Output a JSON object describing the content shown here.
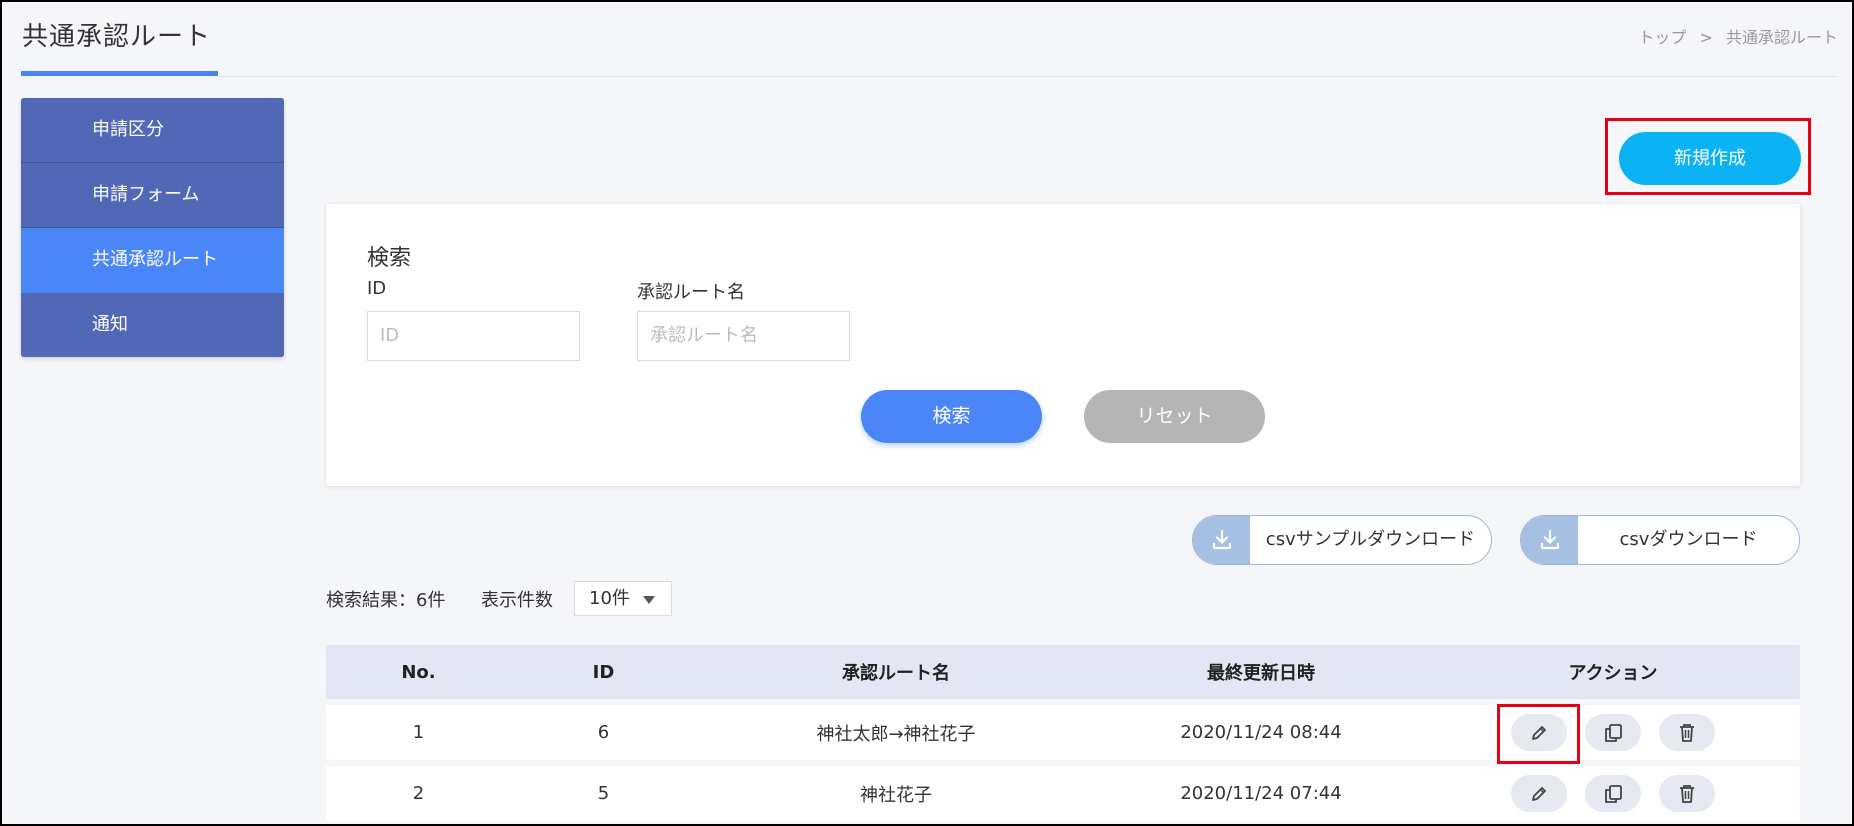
{
  "header": {
    "title": "共通承認ルート",
    "breadcrumb": [
      "トップ",
      "共通承認ルート"
    ],
    "breadcrumb_sep": ">"
  },
  "sidebar": {
    "items": [
      {
        "label": "申請区分",
        "active": false
      },
      {
        "label": "申請フォーム",
        "active": false
      },
      {
        "label": "共通承認ルート",
        "active": true
      },
      {
        "label": "通知",
        "active": false
      }
    ]
  },
  "actions": {
    "new_label": "新規作成"
  },
  "search": {
    "heading": "検索",
    "id_label": "ID",
    "id_placeholder": "ID",
    "name_label": "承認ルート名",
    "name_placeholder": "承認ルート名",
    "search_label": "検索",
    "reset_label": "リセット"
  },
  "csv": {
    "sample_label": "csvサンプルダウンロード",
    "download_label": "csvダウンロード"
  },
  "results": {
    "count_text": "検索結果：6件",
    "per_page_label": "表示件数",
    "per_page_value": "10件"
  },
  "table": {
    "headers": [
      "No.",
      "ID",
      "承認ルート名",
      "最終更新日時",
      "アクション"
    ],
    "rows": [
      {
        "no": "1",
        "id": "6",
        "name": "神社太郎→神社花子",
        "updated": "2020/11/24 08:44"
      },
      {
        "no": "2",
        "id": "5",
        "name": "神社花子",
        "updated": "2020/11/24 07:44"
      }
    ]
  },
  "colors": {
    "accent": "#4a86f7",
    "new_button": "#0bb3f5",
    "sidebar": "#5068b5",
    "highlight": "#e60012"
  },
  "icons": {
    "edit": "pencil-icon",
    "copy": "copy-icon",
    "delete": "trash-icon",
    "download": "download-icon",
    "dropdown": "caret-down-icon"
  }
}
